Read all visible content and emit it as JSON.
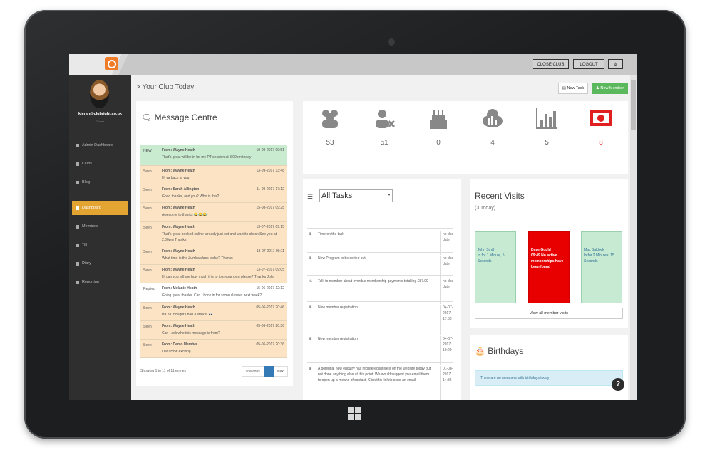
{
  "topbar": {
    "close_club": "CLOSE CLUB",
    "logout": "LOGOUT"
  },
  "sidebar": {
    "user_email": "kieran@clubright.co.uk",
    "user_role": "Owner",
    "items": [
      {
        "label": "Admin Dashboard"
      },
      {
        "label": "Clubs"
      },
      {
        "label": "Blog"
      },
      {
        "label": "Dashboard"
      },
      {
        "label": "Members"
      },
      {
        "label": "Till"
      },
      {
        "label": "Diary"
      },
      {
        "label": "Reporting"
      }
    ]
  },
  "header": {
    "breadcrumb": "> Your Club Today",
    "new_task": "New Task",
    "new_member": "New Member"
  },
  "messages": {
    "title": "Message Centre",
    "rows": [
      {
        "status": "NEW",
        "from": "From: Wayne Heath",
        "date": "19-09-2017 09:51",
        "text": "That's great will be in for my PT session at 3.00pm today"
      },
      {
        "status": "Seen",
        "from": "From: Wayne Heath",
        "date": "13-09-2017 13:48",
        "text": "Hi ya back at you"
      },
      {
        "status": "Seen",
        "from": "From: Sarah Allington",
        "date": "11-09-2017 17:12",
        "text": "Good thanks, and you? Who is this?"
      },
      {
        "status": "Seen",
        "from": "From: Wayne Heath",
        "date": "15-08-2017 09:25",
        "text": "Awesome to thanks 😂😂😂"
      },
      {
        "status": "Seen",
        "from": "From: Wayne Heath",
        "date": "13-07-2017 09:15",
        "text": "That's great booked online already just out and want to check See you at 2.00pm Thanks"
      },
      {
        "status": "Seen",
        "from": "From: Wayne Heath",
        "date": "13-07-2017 09:11",
        "text": "What time is the Zumba class today? Thanks"
      },
      {
        "status": "Seen",
        "from": "From: Wayne Heath",
        "date": "13-07-2017 09:05",
        "text": "Hi can you tell me how much it is to join your gym please? Thanks John"
      },
      {
        "status": "Replied",
        "from": "From: Melanie Heath",
        "date": "15-06-2017 12:12",
        "text": "Going great thanks. Can I book in for some classes next week?"
      },
      {
        "status": "Seen",
        "from": "From: Wayne Heath",
        "date": "05-06-2017 20:46",
        "text": "Ha ha thought I had a stalker 👀"
      },
      {
        "status": "Seen",
        "from": "From: Wayne Heath",
        "date": "05-06-2017 20:36",
        "text": "Can I ask who this message is from?"
      },
      {
        "status": "Seen",
        "from": "From: Demo Member",
        "date": "05-06-2017 20:36",
        "text": "I did! How exciting"
      }
    ],
    "pager_info": "Showing 1 to 11 of 11 entries",
    "prev": "Previous",
    "page": "1",
    "next": "Next"
  },
  "stats": [
    {
      "icon": "members-group-icon",
      "value": "53",
      "color": "#666666"
    },
    {
      "icon": "user-removed-icon",
      "value": "51",
      "color": "#666666"
    },
    {
      "icon": "birthday-cake-icon",
      "value": "0",
      "color": "#666666"
    },
    {
      "icon": "cloud-chart-icon",
      "value": "4",
      "color": "#666666"
    },
    {
      "icon": "bar-chart-icon",
      "value": "5",
      "color": "#666666"
    },
    {
      "icon": "money-icon",
      "value": "8",
      "color": "#e02020"
    }
  ],
  "tasks": {
    "select_value": "All Tasks",
    "rows": [
      {
        "icon": "⬇",
        "text": "Time on the task",
        "due": "no due date"
      },
      {
        "icon": "⬇",
        "text": "New Program to be sorted out",
        "due": "no due date"
      },
      {
        "icon": "⚠",
        "text": "Talk to member about overdue membership payments totalling £87.00",
        "due": "no due date"
      },
      {
        "icon": "⬇",
        "text": "New member registration",
        "due": "04-07-2017 17:35"
      },
      {
        "icon": "⬇",
        "text": "New member registration",
        "due": "04-07-2017 19:20"
      },
      {
        "icon": "⬇",
        "text": "A potential new enquiry has registered interest on the website today but not done anything else at this point. We would suggest you email them to open up a means of contact. Click this link to send an email",
        "due": "01-08-2017 14:36"
      }
    ]
  },
  "visits": {
    "title": "Recent Visits",
    "subtitle": "(3 Today)",
    "cards": [
      {
        "name": "John Smith",
        "text": "In for 1 Minute, 5 Seconds"
      },
      {
        "name": "Dave Gould",
        "text": "09:49 No active memberships have been found"
      },
      {
        "name": "Max Baldock",
        "text": "In for 2 Minutes, 15 Seconds"
      }
    ],
    "view_all": "View all member visits"
  },
  "birthdays": {
    "title": "Birthdays",
    "message": "There are no members with birthdays today"
  },
  "help": "?"
}
